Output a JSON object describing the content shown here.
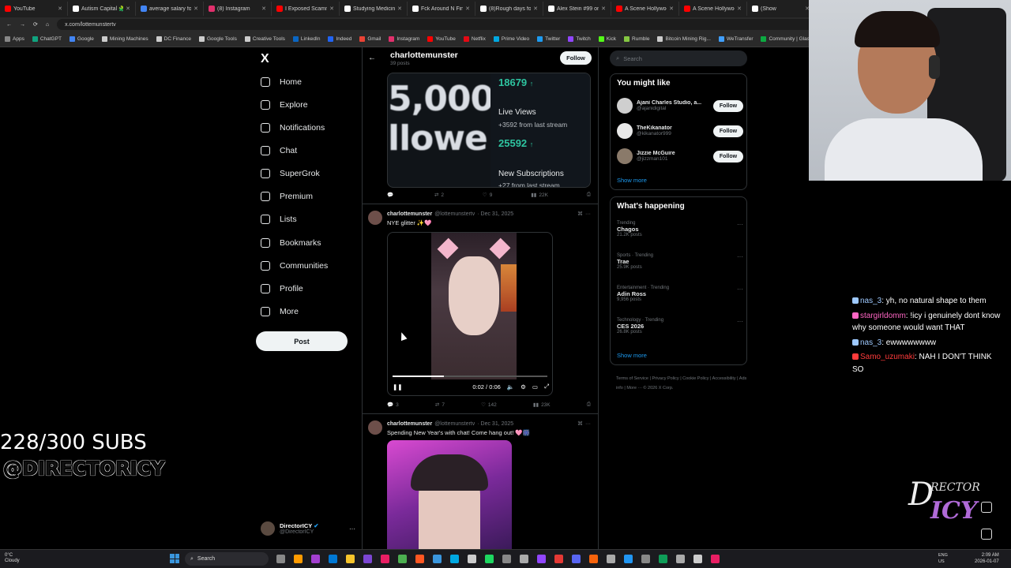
{
  "browser": {
    "tabs": [
      {
        "label": "YouTube",
        "color": "#ff0000"
      },
      {
        "label": "Autism Capital 🧩",
        "color": "#ffffff"
      },
      {
        "label": "average salary for a",
        "color": "#4285f4"
      },
      {
        "label": "(8) Instagram",
        "color": "#e1306c"
      },
      {
        "label": "I Exposed Scammers",
        "color": "#ff0000"
      },
      {
        "label": "Studying Medicine",
        "color": "#ffffff"
      },
      {
        "label": "Fck Around N Find",
        "color": "#ffffff"
      },
      {
        "label": "(8)Rough days for U",
        "color": "#ffffff"
      },
      {
        "label": "Alex Stein #99 on X",
        "color": "#ffffff"
      },
      {
        "label": "A Scene Hollywood",
        "color": "#ff0000"
      },
      {
        "label": "A Scene Hollywood",
        "color": "#ff0000"
      },
      {
        "label": "(Show",
        "color": "#ffffff"
      }
    ],
    "url": "x.com/lottemunstertv",
    "bookmarks": [
      "Apps",
      "ChatGPT",
      "Google",
      "Mining Machines",
      "DC Finance",
      "Google Tools",
      "Creative Tools",
      "LinkedIn",
      "Indeed",
      "Gmail",
      "Instagram",
      "YouTube",
      "Netflix",
      "Prime Video",
      "Twitter",
      "Twitch",
      "Kick",
      "Rumble",
      "Bitcoin Mining Rig...",
      "WeTransfer",
      "Community | Glassd..."
    ]
  },
  "nav": {
    "logo": "X",
    "items": [
      "Home",
      "Explore",
      "Notifications",
      "Chat",
      "SuperGrok",
      "Premium",
      "Lists",
      "Bookmarks",
      "Communities",
      "Profile",
      "More"
    ],
    "post_label": "Post",
    "account": {
      "name": "DirectorICY",
      "handle": "@DirectorICY",
      "more": "···"
    }
  },
  "profile": {
    "back": "←",
    "name": "charlottemunster",
    "posts": "39 posts",
    "follow_label": "Follow"
  },
  "tweet1": {
    "image": {
      "big_text": "5,000 llowe",
      "stat1_value": "18679",
      "stat1_arrow": "↑",
      "stat2_label": "Live Views",
      "stat2_sub": "+3592 from last stream",
      "stat3_value": "25592",
      "stat3_arrow": "↑",
      "stat4_label": "New Subscriptions",
      "stat4_sub": "+27 from last stream"
    },
    "actions": {
      "replies": "",
      "reposts": "2",
      "likes": "9",
      "views": "22K"
    }
  },
  "tweet2": {
    "name": "charlottemunster",
    "handle": "@lottemunstertv",
    "date": "· Dec 31, 2025",
    "text": "NYE glitter ✨🩷",
    "video": {
      "time": "0:02 / 0:06",
      "progress": 0.33
    },
    "actions": {
      "replies": "3",
      "reposts": "7",
      "likes": "142",
      "views": "23K"
    }
  },
  "tweet3": {
    "name": "charlottemunster",
    "handle": "@lottemunstertv",
    "date": "· Dec 31, 2025",
    "text": "Spending New Year's with chat! Come hang out! 🩷🎆"
  },
  "right": {
    "search_placeholder": "Search",
    "you_might_like": {
      "title": "You might like",
      "users": [
        {
          "name": "Ajani Charles Studio, a...",
          "handle": "@ajanidigital",
          "follow": "Follow"
        },
        {
          "name": "TheKikanator",
          "handle": "@kikanator999",
          "follow": "Follow"
        },
        {
          "name": "Jizzie McGuire",
          "handle": "@jizzman101",
          "follow": "Follow"
        }
      ],
      "show_more": "Show more"
    },
    "whats_happening": {
      "title": "What's happening",
      "trends": [
        {
          "context": "Trending",
          "name": "Chagos",
          "count": "21.2K posts"
        },
        {
          "context": "Sports · Trending",
          "name": "Trae",
          "count": "25.9K posts"
        },
        {
          "context": "Entertainment · Trending",
          "name": "Adin Ross",
          "count": "9,956 posts"
        },
        {
          "context": "Technology · Trending",
          "name": "CES 2026",
          "count": "26.8K posts"
        }
      ],
      "show_more": "Show more"
    },
    "footer": "Terms of Service  |  Privacy Policy  |  Cookie Policy  |  Accessibility  |  Ads info  |  More ···  © 2026 X Corp."
  },
  "overlay": {
    "subs": "228/300 SUBS",
    "handle": "@DIRECTORICY",
    "chat": [
      {
        "user": "nas_3",
        "text": ": yh, no natural shape to them",
        "color": "#9ec9ff"
      },
      {
        "user": "stargirldomm",
        "text": ": !icy i genuinely dont know why someone would want THAT",
        "color": "#ff66c4"
      },
      {
        "user": "nas_3",
        "text": ": ewwwwwwww",
        "color": "#9ec9ff"
      },
      {
        "user": "Samo_uzumaki",
        "text": ": NAH I DON'T THINK SO",
        "color": "#ff3b3b"
      }
    ],
    "brand_d": "D",
    "brand_rest": "RECTOR",
    "brand_icy": "ICY"
  },
  "taskbar": {
    "weather_temp": "0°C",
    "weather_desc": "Cloudy",
    "search": "Search",
    "lang1": "ENG",
    "lang2": "US",
    "time": "2:09 AM",
    "date": "2026-01-07"
  }
}
